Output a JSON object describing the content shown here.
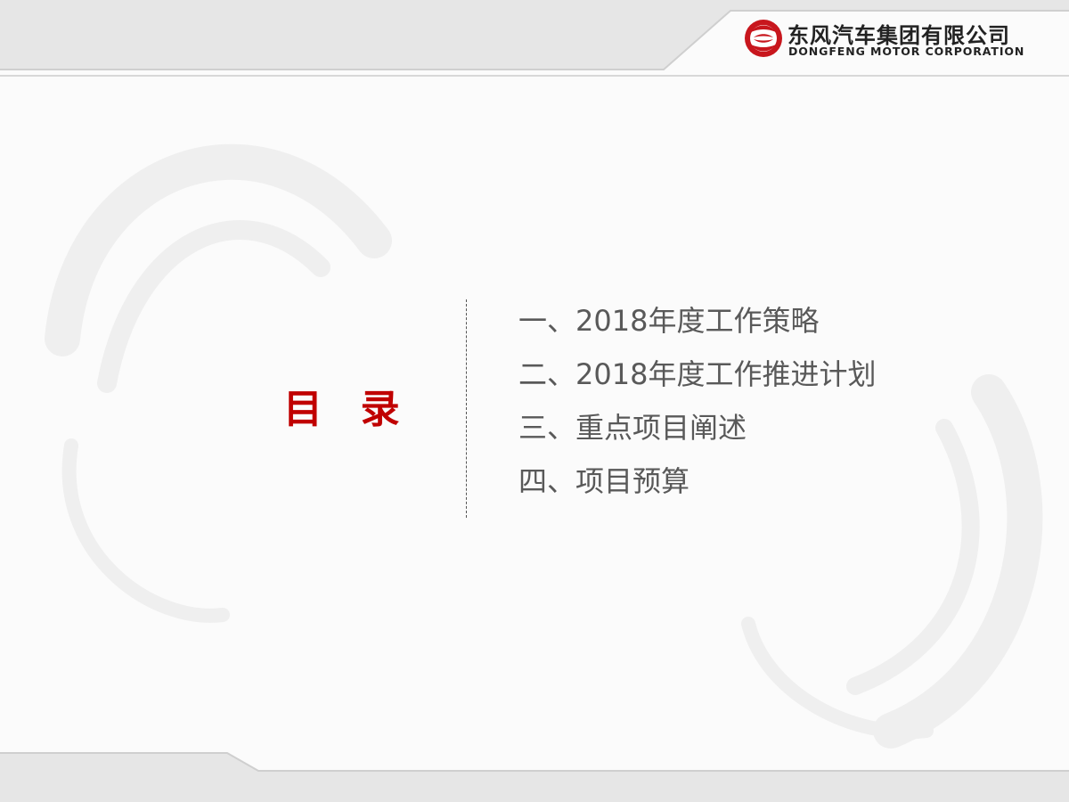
{
  "brand": {
    "name_cn": "东风汽车集团有限公司",
    "name_en": "DONGFENG MOTOR CORPORATION",
    "logo_icon": "dongfeng-logo-icon",
    "logo_color": "#c8161d"
  },
  "toc": {
    "title": "目  录",
    "title_color": "#c00000",
    "items": [
      {
        "label": "一、2018年度工作策略"
      },
      {
        "label": "二、2018年度工作推进计划"
      },
      {
        "label": "三、重点项目阐述"
      },
      {
        "label": "四、项目预算"
      }
    ],
    "item_color": "#595959"
  },
  "decoration": {
    "background_icon": "swirl-watermark-icon",
    "band_color": "#e6e6e6"
  }
}
